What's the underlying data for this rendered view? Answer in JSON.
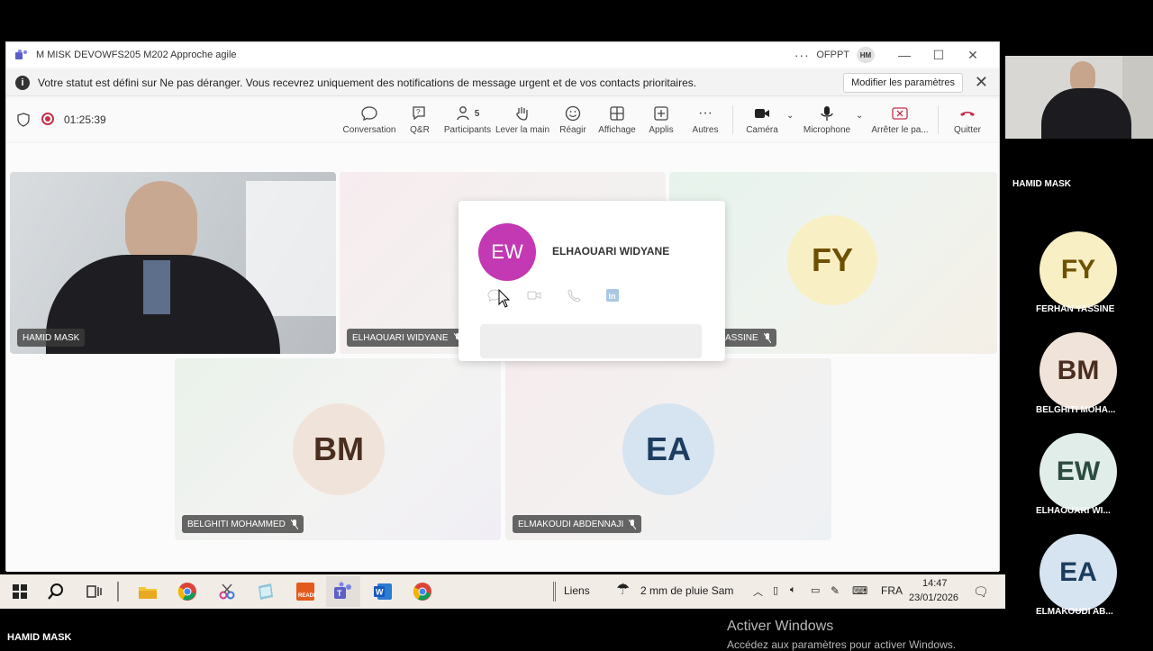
{
  "window": {
    "title": "M MISK DEVOWFS205 M202 Approche agile",
    "org": "OFPPT",
    "user_initials": "HM"
  },
  "notification": {
    "message": "Votre statut est défini sur Ne pas déranger. Vous recevrez uniquement des notifications de message urgent et de vos contacts prioritaires.",
    "button": "Modifier les paramètres"
  },
  "toolbar": {
    "timer": "01:25:39",
    "items": [
      {
        "label": "Conversation",
        "icon": "chat-icon"
      },
      {
        "label": "Q&R",
        "icon": "qa-icon"
      },
      {
        "label": "Participants",
        "icon": "people-icon",
        "count": "5"
      },
      {
        "label": "Lever la main",
        "icon": "hand-icon"
      },
      {
        "label": "Réagir",
        "icon": "smile-icon"
      },
      {
        "label": "Affichage",
        "icon": "grid-icon"
      },
      {
        "label": "Applis",
        "icon": "plus-icon"
      },
      {
        "label": "Autres",
        "icon": "more-icon"
      },
      {
        "label": "Caméra",
        "icon": "camera-icon"
      },
      {
        "label": "Microphone",
        "icon": "mic-icon"
      },
      {
        "label": "Arrêter le pa...",
        "icon": "stop-share-icon"
      },
      {
        "label": "Quitter",
        "icon": "hangup-icon"
      }
    ]
  },
  "participants": {
    "hamid": "HAMID MASK",
    "widyane": "ELHAOUARI WIDYANE",
    "yassine_partial": "ASSINE",
    "yassine_initials": "FY",
    "belghiti": "BELGHITI MOHAMMED",
    "belghiti_initials": "BM",
    "elmakoudi": "ELMAKOUDI ABDENNAJI",
    "elmakoudi_initials": "EA"
  },
  "card": {
    "initials": "EW",
    "name": "ELHAOUARI WIDYANE"
  },
  "watermark": {
    "line1": "Activer Windows",
    "line2": "Accédez aux paramètres pour activer Windows."
  },
  "taskbar": {
    "links": "Liens",
    "weather": "2 mm de pluie Sam",
    "lang": "FRA",
    "time": "14:47",
    "date": "23/01/2026"
  },
  "right_panel": {
    "self_name": "HAMID MASK",
    "people": [
      {
        "initials": "FY",
        "name": "FERHAN YASSINE"
      },
      {
        "initials": "BM",
        "name": "BELGHITI MOHA..."
      },
      {
        "initials": "EW",
        "name": "ELHAOUARI WI..."
      },
      {
        "initials": "EA",
        "name": "ELMAKOUDI AB..."
      }
    ]
  },
  "bottom_label": "HAMID MASK",
  "colors": {
    "accent_purple": "#c239b3",
    "hangup_red": "#c4314b",
    "fy_bg": "#f8efc5",
    "bm_bg": "#f0e3da",
    "ew_bg": "#e0ede9",
    "ea_bg": "#d6e3f0"
  }
}
